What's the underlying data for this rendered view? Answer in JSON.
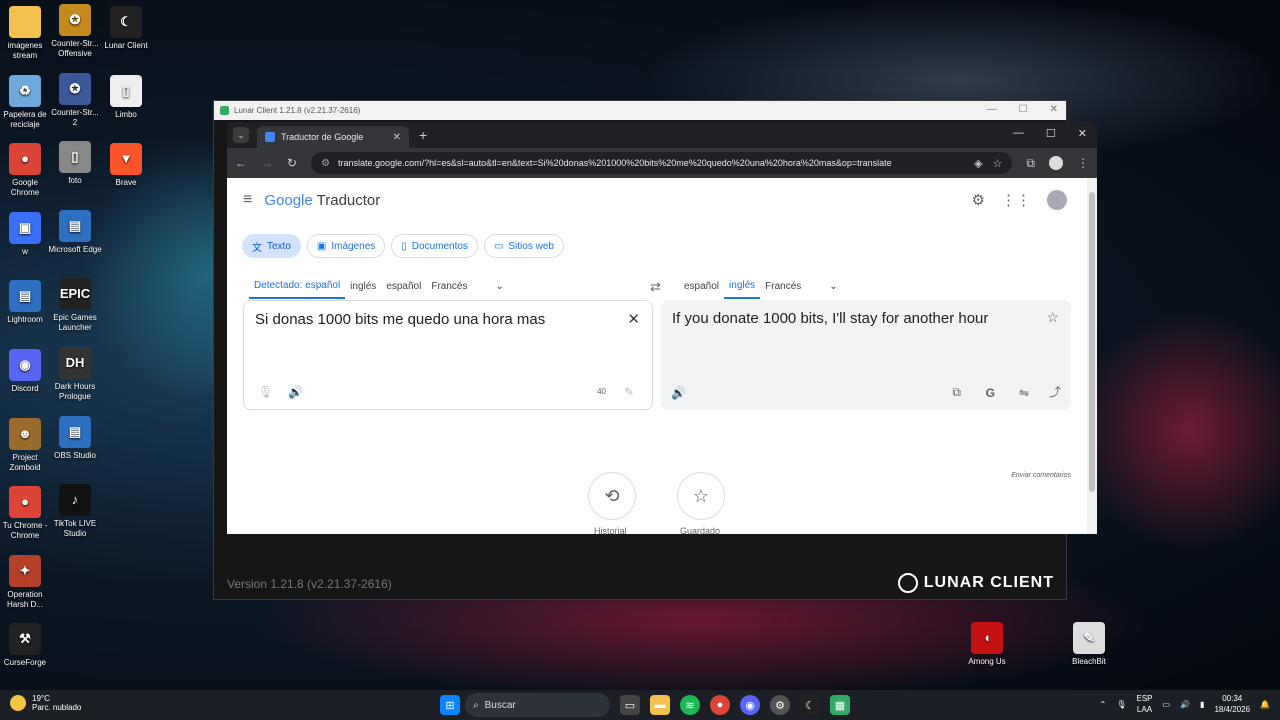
{
  "desktop": {
    "icons_left": [
      {
        "label": "imagenes stream",
        "color": "#f2c14e",
        "glyph": ""
      },
      {
        "label": "Papelera de reciclaje",
        "color": "#6fa8dc",
        "glyph": "♻"
      },
      {
        "label": "Google Chrome",
        "color": "#db4437",
        "glyph": "●"
      },
      {
        "label": "w",
        "color": "#3a6ff7",
        "glyph": "▣"
      },
      {
        "label": "Lightroom",
        "color": "#2d6fc0",
        "glyph": "▤"
      },
      {
        "label": "Discord",
        "color": "#5865f2",
        "glyph": "◉"
      },
      {
        "label": "Project Zomboid",
        "color": "#9a6b2c",
        "glyph": "☻"
      },
      {
        "label": "Tu Chrome - Chrome",
        "color": "#db4437",
        "glyph": "●"
      },
      {
        "label": "Operation Harsh D...",
        "color": "#b3412a",
        "glyph": "✦"
      },
      {
        "label": "CurseForge",
        "color": "#222",
        "glyph": "⚒"
      }
    ],
    "icons_mid": [
      {
        "label": "Counter-Str... Offensive",
        "color": "#c58a1d",
        "glyph": "✪"
      },
      {
        "label": "Counter-Str... 2",
        "color": "#3b5998",
        "glyph": "✪"
      },
      {
        "label": "foto",
        "color": "#888",
        "glyph": "▯"
      },
      {
        "label": "Microsoft Edge",
        "color": "#2d6fc0",
        "glyph": "▤"
      },
      {
        "label": "Epic Games Launcher",
        "color": "#222",
        "glyph": "EPIC"
      },
      {
        "label": "Dark Hours Prologue",
        "color": "#333",
        "glyph": "DH"
      },
      {
        "label": "OBS Studio",
        "color": "#2d6fc0",
        "glyph": "▤"
      },
      {
        "label": "TikTok LIVE Studio",
        "color": "#111",
        "glyph": "♪"
      }
    ],
    "icons_third": [
      {
        "label": "Lunar Client",
        "color": "#222",
        "glyph": "☾"
      },
      {
        "label": "Limbo",
        "color": "#eee",
        "glyph": "▯"
      },
      {
        "label": "Brave",
        "color": "#fb542b",
        "glyph": "▼"
      }
    ],
    "icons_right": [
      {
        "label": "Among Us",
        "color": "#c51111",
        "glyph": "◖"
      },
      {
        "label": "BleachBit",
        "color": "#ddd",
        "glyph": "✎"
      }
    ]
  },
  "lunar": {
    "title": "Lunar Client 1.21.8 (v2.21.37-2616)",
    "version": "Version 1.21.8 (v2.21.37-2616)",
    "brand": "LUNAR CLIENT"
  },
  "chrome": {
    "tab_title": "Traductor de Google",
    "url": "translate.google.com/?hl=es&sl=auto&tl=en&text=Si%20donas%201000%20bits%20me%20quedo%20una%20hora%20mas&op=translate"
  },
  "translate": {
    "logo_google": "Google",
    "logo_product": "Traductor",
    "chips": [
      "Texto",
      "Imágenes",
      "Documentos",
      "Sitios web"
    ],
    "source_langs": [
      "Detectado: español",
      "inglés",
      "español",
      "Francés"
    ],
    "target_langs": [
      "español",
      "inglés",
      "Francés"
    ],
    "source_text": "Si donas 1000 bits me quedo una hora mas",
    "target_text": "If you donate 1000 bits, I'll stay for another hour",
    "char_count": "40",
    "feedback": "Enviar comentarios",
    "history_label": "Historial",
    "saved_label": "Guardado"
  },
  "taskbar": {
    "temp": "19°C",
    "weather": "Parc. nublado",
    "search_placeholder": "Buscar",
    "lang": "ESP",
    "lang2": "LAA",
    "time": "00:34",
    "date": "18/4/2026"
  }
}
